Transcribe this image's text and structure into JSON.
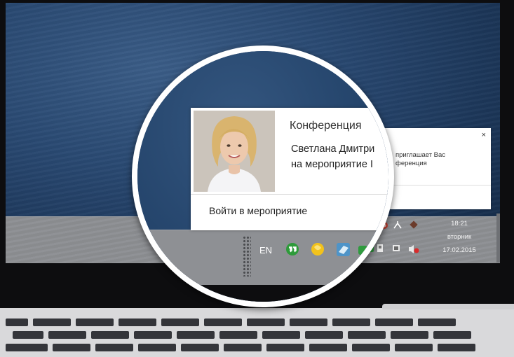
{
  "notification": {
    "title": "Конференция",
    "message_line1": "Светлана Дмитри",
    "message_line2": "на мероприятие I",
    "action_label": "Войти в мероприятие",
    "small_text_line1": "приглашает Вас",
    "small_text_line2": "ференция",
    "close_glyph": "×"
  },
  "taskbar": {
    "language": "EN",
    "clock": {
      "time": "18:21",
      "weekday": "вторник",
      "date": "17.02.2015"
    }
  },
  "colors": {
    "desktop_wallpaper": "#24446b",
    "taskbar": "#8e9094",
    "hangouts_icon": "#2e9b3a",
    "yellow_icon": "#f2c21b"
  },
  "icons": [
    "hangouts-icon",
    "yellow-app-icon",
    "cube-app-icon",
    "network-icon",
    "flag-icon",
    "speaker-icon",
    "power-icon"
  ]
}
